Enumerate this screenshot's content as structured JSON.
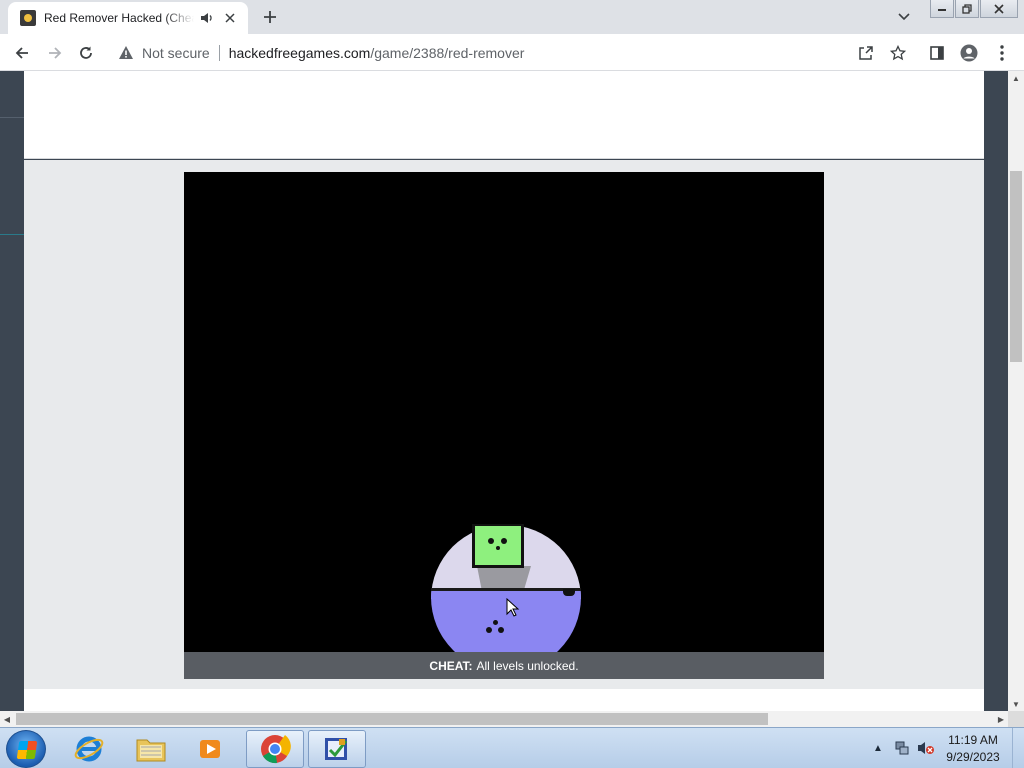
{
  "browser": {
    "tab": {
      "title": "Red Remover Hacked (Cheat: All levels unlocked)",
      "audio_icon": "speaker-icon",
      "close_icon": "close-icon"
    },
    "new_tab_icon": "plus-icon",
    "tab_search_icon": "chevron-down-icon",
    "window_controls": [
      "minimize-icon",
      "restore-icon",
      "close-icon"
    ],
    "toolbar": {
      "back_icon": "back-arrow-icon",
      "forward_icon": "forward-arrow-icon",
      "reload_icon": "reload-icon",
      "security_label": "Not secure",
      "url_host": "hackedfreegames.com",
      "url_path": "/game/2388/red-remover",
      "share_icon": "share-icon",
      "bookmark_icon": "star-icon",
      "sidepanel_icon": "side-panel-icon",
      "profile_icon": "profile-icon",
      "menu_icon": "kebab-menu-icon"
    }
  },
  "page": {
    "game": {
      "name": "Red Remover",
      "cheat_label": "CHEAT:",
      "cheat_text": "All levels unlocked."
    }
  },
  "colors": {
    "page_background": "#3c4652",
    "game_background": "#000000",
    "cheat_bar": "#595d63",
    "green_block": "#8ef07e",
    "blue_dome": "#8b86f2",
    "lilac_dome": "#dcd8ec",
    "taskbar": "#b6cde8"
  },
  "taskbar": {
    "start_icon": "windows-start-icon",
    "apps": [
      {
        "name": "Internet Explorer",
        "icon": "internet-explorer-icon"
      },
      {
        "name": "Windows Explorer",
        "icon": "folder-icon"
      },
      {
        "name": "Windows Media Player",
        "icon": "media-player-icon"
      },
      {
        "name": "Google Chrome",
        "icon": "chrome-icon"
      },
      {
        "name": "App",
        "icon": "checklist-app-icon"
      }
    ],
    "tray_icons": [
      "show-hidden-icons-icon",
      "network-icon",
      "volume-muted-icon"
    ],
    "time": "11:19 AM",
    "date": "9/29/2023"
  }
}
